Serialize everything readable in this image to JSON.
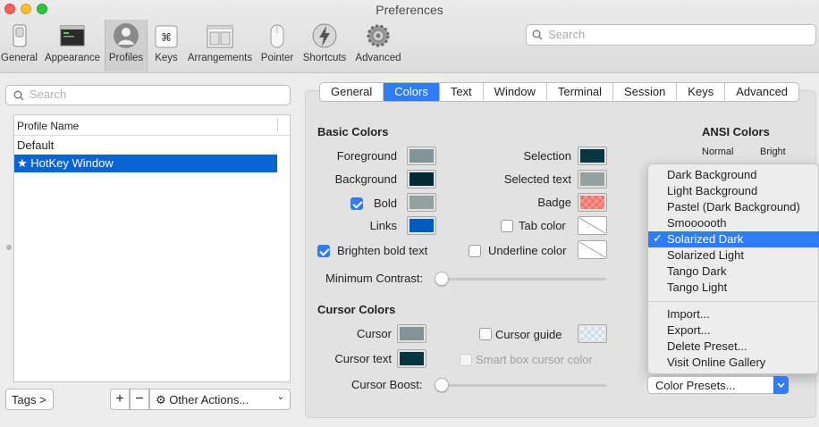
{
  "window": {
    "title": "Preferences"
  },
  "toolbar": {
    "items": [
      {
        "label": "General",
        "icon": "general-switch-icon"
      },
      {
        "label": "Appearance",
        "icon": "appearance-window-icon"
      },
      {
        "label": "Profiles",
        "icon": "profile-person-icon"
      },
      {
        "label": "Keys",
        "icon": "command-key-icon"
      },
      {
        "label": "Arrangements",
        "icon": "arrangements-windows-icon"
      },
      {
        "label": "Pointer",
        "icon": "mouse-pointer-icon"
      },
      {
        "label": "Shortcuts",
        "icon": "lightning-bolt-icon"
      },
      {
        "label": "Advanced",
        "icon": "gear-icon"
      }
    ],
    "active": "Profiles",
    "search_placeholder": "Search"
  },
  "profiles": {
    "search_placeholder": "Search",
    "column_header": "Profile Name",
    "items": [
      {
        "name": "Default",
        "selected": false
      },
      {
        "name": "HotKey Window",
        "selected": true,
        "star": "★"
      }
    ],
    "tags_button": "Tags >",
    "add_button": "+",
    "remove_button": "−",
    "other_actions": "Other Actions..."
  },
  "tabs": {
    "items": [
      "General",
      "Colors",
      "Text",
      "Window",
      "Terminal",
      "Session",
      "Keys",
      "Advanced"
    ],
    "active": "Colors"
  },
  "basic_colors": {
    "title": "Basic Colors",
    "foreground": {
      "label": "Foreground",
      "color": "#839496"
    },
    "background": {
      "label": "Background",
      "color": "#002b36"
    },
    "bold": {
      "label": "Bold",
      "color": "#93a1a1",
      "checked": true
    },
    "links": {
      "label": "Links",
      "color": "#005bbb"
    },
    "selection": {
      "label": "Selection",
      "color": "#073642"
    },
    "selected_text": {
      "label": "Selected text",
      "color": "#93a1a1"
    },
    "badge": {
      "label": "Badge",
      "color": "#f0736a"
    },
    "tab_color": {
      "label": "Tab color",
      "checked": false
    },
    "brighten_bold": {
      "label": "Brighten bold text",
      "checked": true
    },
    "underline_color": {
      "label": "Underline color",
      "checked": false
    },
    "minimum_contrast": {
      "label": "Minimum Contrast:",
      "value": 0
    }
  },
  "cursor_colors": {
    "title": "Cursor Colors",
    "cursor": {
      "label": "Cursor",
      "color": "#839496"
    },
    "cursor_text": {
      "label": "Cursor text",
      "color": "#073642"
    },
    "cursor_guide": {
      "label": "Cursor guide",
      "checked": false
    },
    "smart_box": {
      "label": "Smart box cursor color",
      "checked": false,
      "disabled": true
    },
    "cursor_boost": {
      "label": "Cursor Boost:",
      "value": 0
    }
  },
  "ansi": {
    "title": "ANSI Colors",
    "normal_label": "Normal",
    "bright_label": "Bright"
  },
  "presets_menu": {
    "items": [
      "Dark Background",
      "Light Background",
      "Pastel (Dark Background)",
      "Smoooooth",
      "Solarized Dark",
      "Solarized Light",
      "Tango Dark",
      "Tango Light"
    ],
    "selected": "Solarized Dark",
    "checkmark": "✓",
    "actions": [
      "Import...",
      "Export...",
      "Delete Preset...",
      "Visit Online Gallery"
    ],
    "button_label": "Color Presets..."
  }
}
